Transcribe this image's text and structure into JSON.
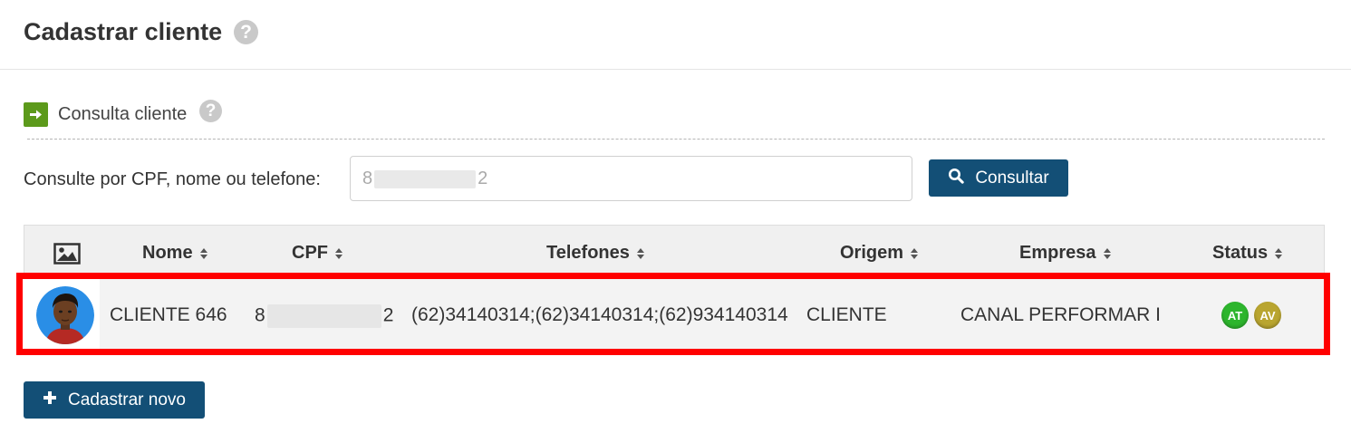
{
  "header": {
    "title": "Cadastrar cliente",
    "help": "?"
  },
  "section": {
    "title": "Consulta cliente",
    "help": "?"
  },
  "search": {
    "label": "Consulte por CPF, nome ou telefone:",
    "value_start": "8",
    "value_end": "2",
    "button_label": "Consultar"
  },
  "table": {
    "columns": [
      "Nome",
      "CPF",
      "Telefones",
      "Origem",
      "Empresa",
      "Status"
    ],
    "rows": [
      {
        "nome": "CLIENTE 646",
        "cpf_start": "8",
        "cpf_end": "2",
        "telefones": "(62)34140314;(62)34140314;(62)934140314",
        "origem": "CLIENTE",
        "empresa": "CANAL PERFORMAR I",
        "status": [
          {
            "label": "AT",
            "color": "#2db52d"
          },
          {
            "label": "AV",
            "color": "#b9a530"
          }
        ]
      }
    ]
  },
  "actions": {
    "new_label": "Cadastrar novo"
  },
  "colors": {
    "primary": "#134f76",
    "accent_green": "#5c9a1b",
    "highlight": "#ff0000"
  }
}
